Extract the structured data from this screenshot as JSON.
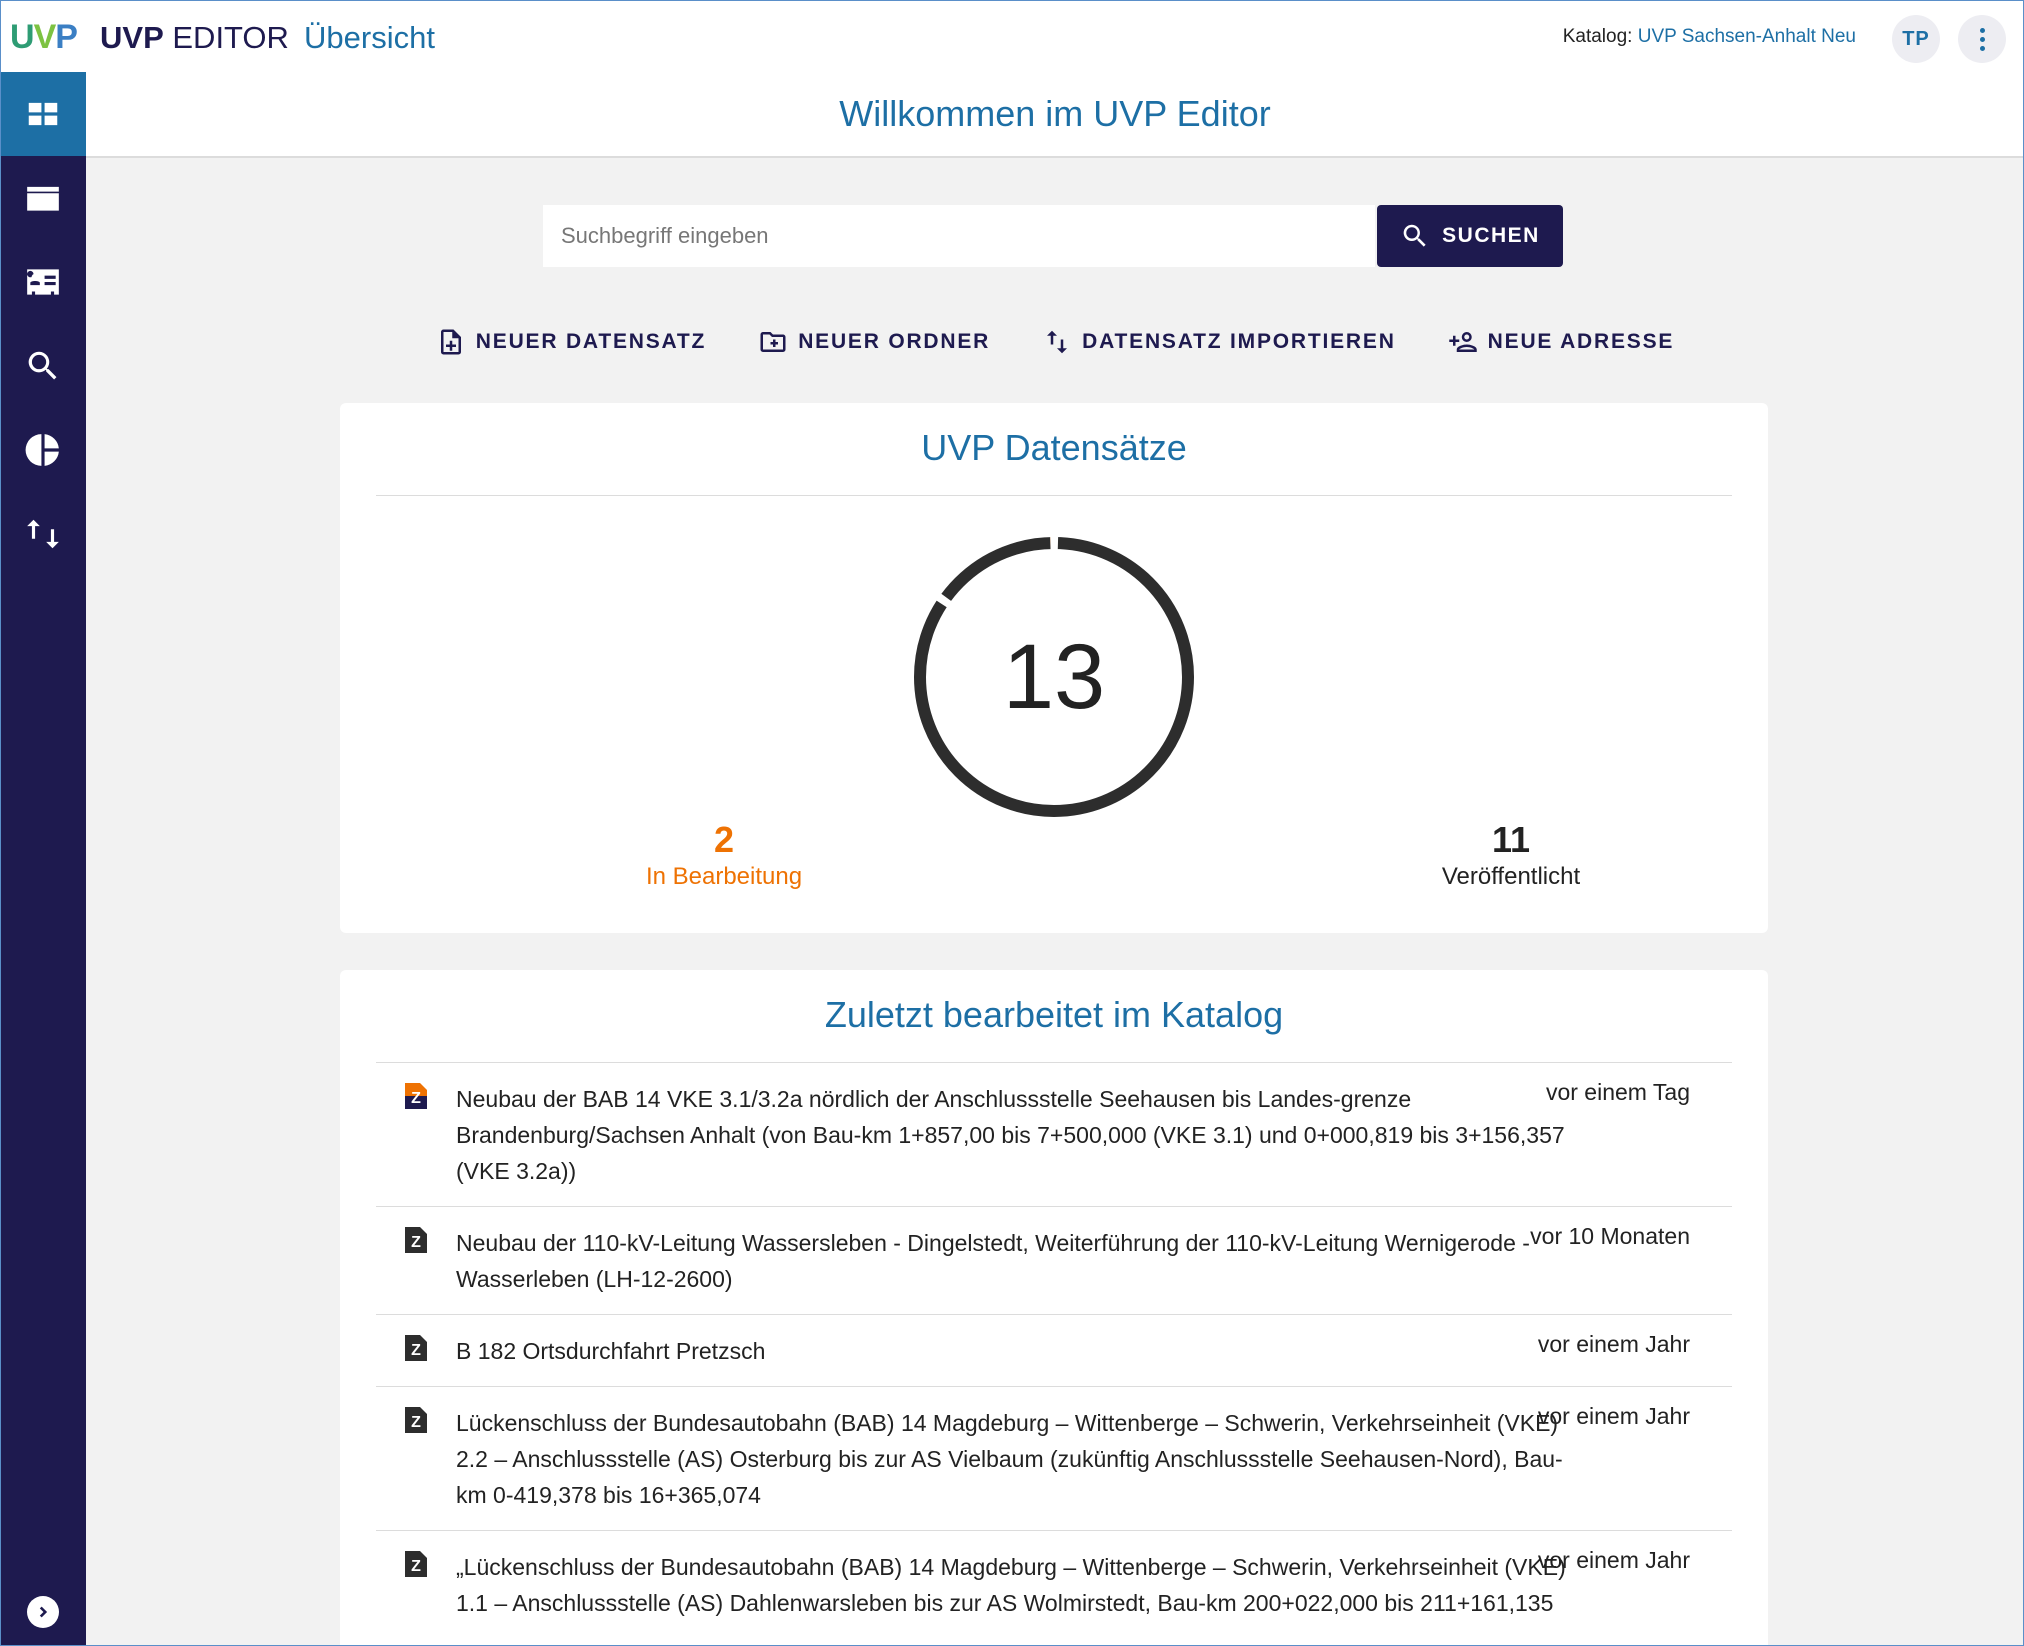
{
  "header": {
    "logo_text": "UVP",
    "app_name_bold": "UVP",
    "app_name_rest": "EDITOR",
    "breadcrumb": "Übersicht",
    "catalog_label": "Katalog:",
    "catalog_name": "UVP Sachsen-Anhalt Neu",
    "user_initials": "TP"
  },
  "sidebar": {
    "items": [
      {
        "icon": "dashboard-icon",
        "active": true
      },
      {
        "icon": "folder-icon",
        "active": false
      },
      {
        "icon": "address-card-icon",
        "active": false
      },
      {
        "icon": "search-icon",
        "active": false
      },
      {
        "icon": "pie-chart-icon",
        "active": false
      },
      {
        "icon": "import-export-icon",
        "active": false
      }
    ],
    "expand_icon": "chevron-right-icon"
  },
  "welcome": {
    "title": "Willkommen im UVP Editor"
  },
  "search": {
    "placeholder": "Suchbegriff eingeben",
    "value": "",
    "button_label": "SUCHEN"
  },
  "actions": {
    "new_dataset": "NEUER DATENSATZ",
    "new_folder": "NEUER ORDNER",
    "import_dataset": "DATENSATZ IMPORTIEREN",
    "new_address": "NEUE ADRESSE"
  },
  "stats": {
    "title": "UVP Datensätze",
    "total": "13",
    "in_progress_count": "2",
    "in_progress_label": "In Bearbeitung",
    "published_count": "11",
    "published_label": "Veröffentlicht",
    "in_progress_fraction": 0.1538
  },
  "recent": {
    "title": "Zuletzt bearbeitet im Katalog",
    "items": [
      {
        "title": "Neubau der BAB 14 VKE 3.1/3.2a nördlich der Anschlussstelle Seehausen bis Landes-grenze Brandenburg/Sachsen Anhalt (von Bau-km 1+857,00 bis 7+500,000 (VKE 3.1) und 0+000,819 bis 3+156,357 (VKE 3.2a))",
        "time": "vor einem Tag",
        "status": "in-progress"
      },
      {
        "title": "Neubau der 110-kV-Leitung Wassersleben - Dingelstedt, Weiterführung der 110-kV-Leitung Wernigerode - Wasserleben (LH-12-2600)",
        "time": "vor 10 Monaten",
        "status": "published"
      },
      {
        "title": "B 182 Ortsdurchfahrt Pretzsch",
        "time": "vor einem Jahr",
        "status": "published"
      },
      {
        "title": "Lückenschluss der Bundesautobahn (BAB) 14 Magdeburg – Wittenberge – Schwerin, Verkehrseinheit (VKE) 2.2 – Anschlussstelle (AS) Osterburg bis zur AS Vielbaum (zukünftig Anschlussstelle Seehausen-Nord), Bau-km 0-419,378 bis 16+365,074",
        "time": "vor einem Jahr",
        "status": "published"
      },
      {
        "title": "„Lückenschluss der Bundesautobahn (BAB) 14 Magdeburg – Wittenberge – Schwerin, Verkehrseinheit (VKE) 1.1 – Anschlussstelle (AS) Dahlenwarsleben bis zur AS Wolmirstedt, Bau-km 200+022,000 bis 211+161,135",
        "time": "vor einem Jahr",
        "status": "published"
      }
    ],
    "doc_letter": "Z"
  },
  "colors": {
    "brand_dark": "#1e1a4f",
    "brand_blue": "#1d6fa5",
    "accent_orange": "#ee7203"
  }
}
